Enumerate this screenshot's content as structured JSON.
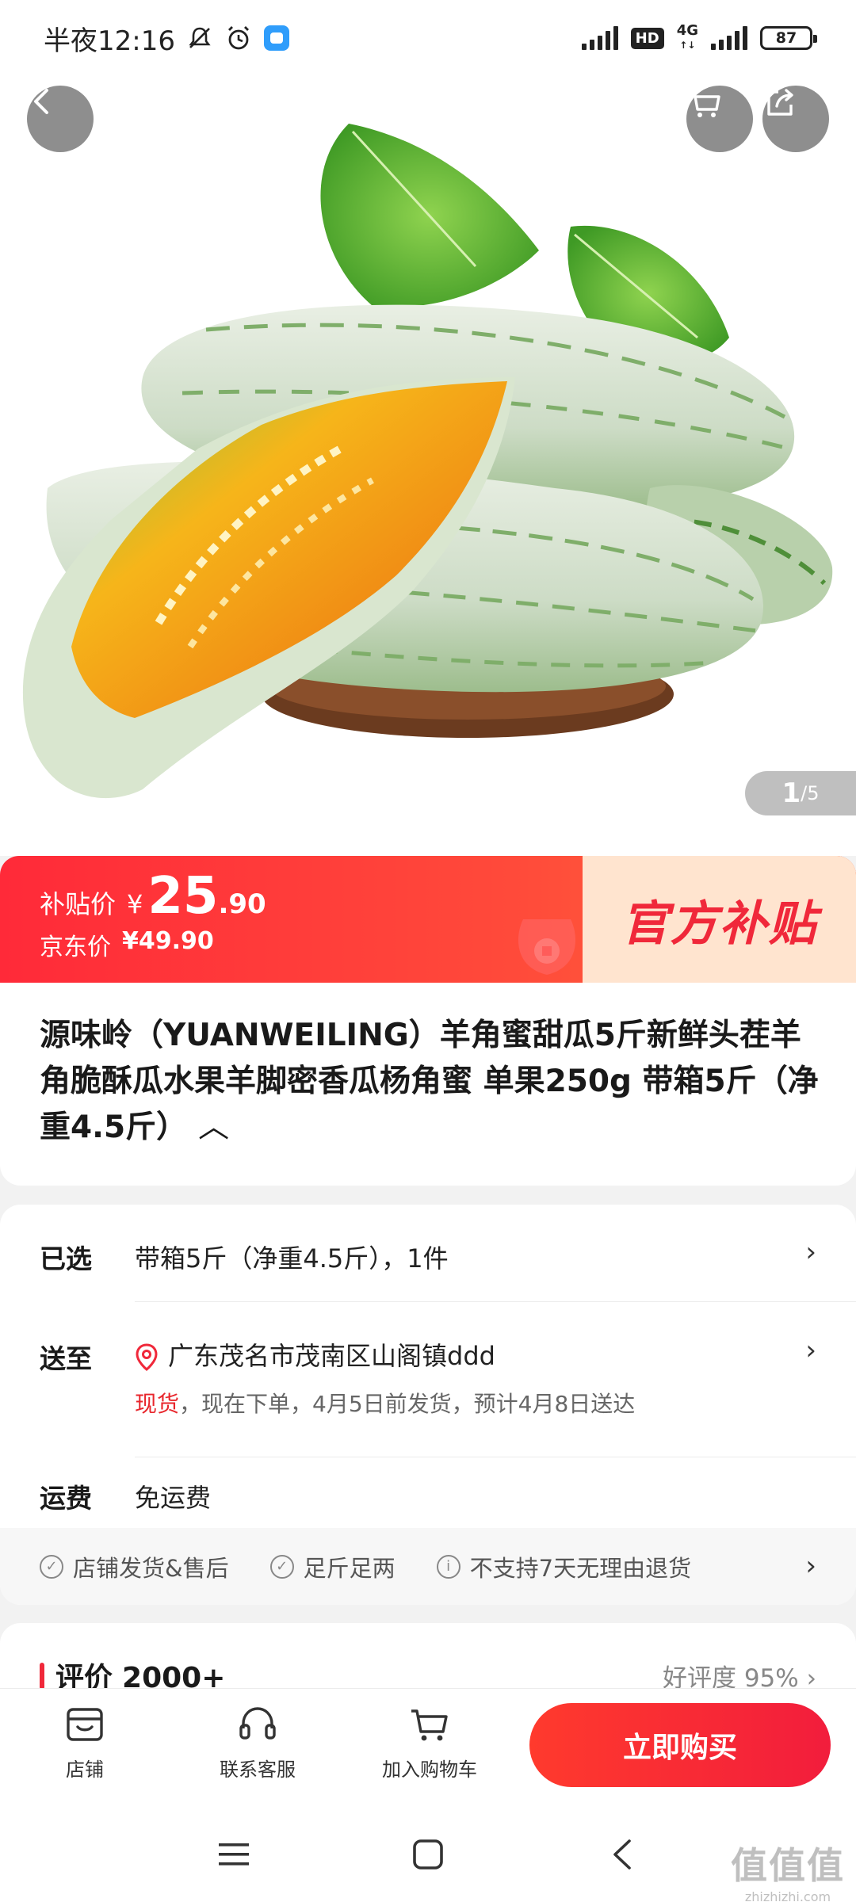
{
  "status_bar": {
    "time": "半夜12:16",
    "hd": "HD",
    "network": "4G",
    "battery": "87",
    "icons": [
      "bell-off-icon",
      "alarm-icon",
      "app-notification-icon",
      "signal-icon",
      "signal-icon",
      "battery-icon"
    ]
  },
  "hero": {
    "page_current": "1",
    "page_total": "/5",
    "icons": [
      "back-arrow-icon",
      "cart-icon",
      "share-icon"
    ]
  },
  "price": {
    "subsidy_label": "补贴价",
    "currency": "¥",
    "subsidy_int": "25",
    "subsidy_dec": ".90",
    "jd_label": "京东价",
    "jd_value": "¥49.90",
    "official_badge": "官方补贴"
  },
  "product": {
    "title": "源味岭（YUANWEILING）羊角蜜甜瓜5斤新鲜头茬羊角脆酥瓜水果羊脚密香瓜杨角蜜 单果250g 带箱5斤（净重4.5斤）",
    "collapse_icon": "︿"
  },
  "info": {
    "selected_label": "已选",
    "selected_value": "带箱5斤（净重4.5斤），1件",
    "ship_label": "送至",
    "ship_address": "广东茂名市茂南区山阁镇ddd",
    "stock_status": "现货",
    "stock_detail": "，现在下单，4月5日前发货，预计4月8日送达",
    "fee_label": "运费",
    "fee_value": "免运费",
    "chevron": "›",
    "services": [
      {
        "icon": "check-circle-icon",
        "label": "店铺发货&售后"
      },
      {
        "icon": "check-circle-icon",
        "label": "足斤足两"
      },
      {
        "icon": "info-circle-icon",
        "label": "不支持7天无理由退货"
      }
    ]
  },
  "review": {
    "title": "评价",
    "count": "2000+",
    "rate": "好评度 95% ›"
  },
  "bottom_bar": {
    "store": "店铺",
    "service": "联系客服",
    "add_cart": "加入购物车",
    "buy_now": "立即购买"
  },
  "watermark": {
    "big": "值值值",
    "small": "zhizhizhi.com"
  },
  "colors": {
    "accent_red": "#f0283a",
    "banner_start": "#ff2a39",
    "official_bg": "#ffe4cf"
  }
}
